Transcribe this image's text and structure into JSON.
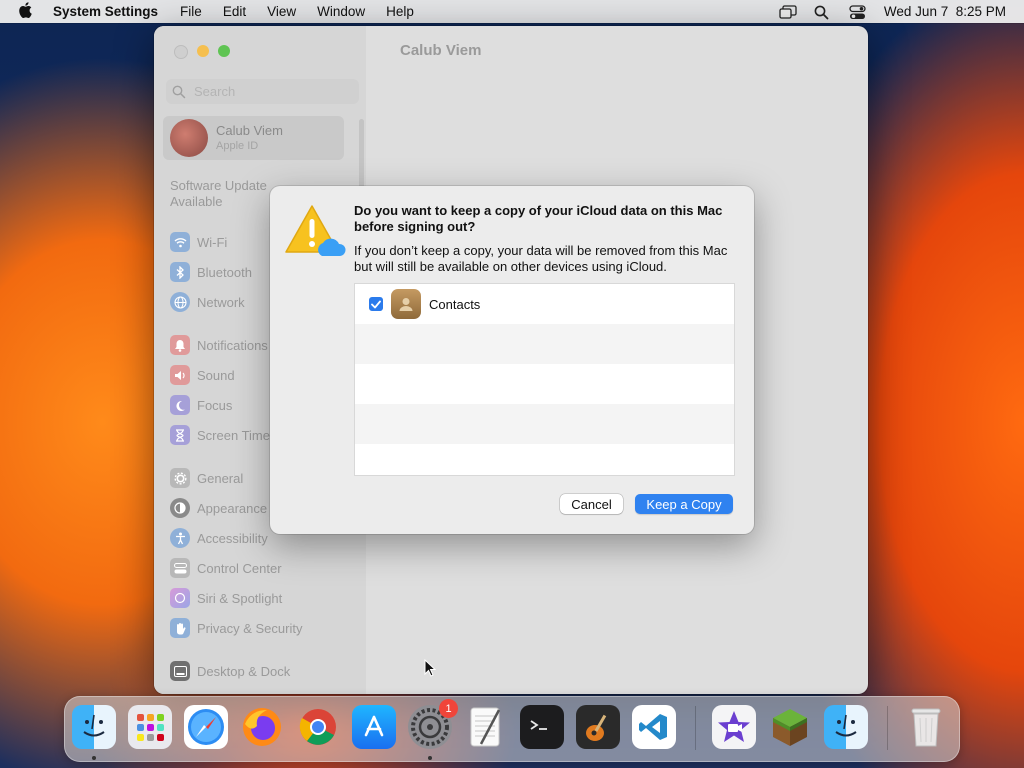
{
  "menubar": {
    "app_name": "System Settings",
    "items": [
      "File",
      "Edit",
      "View",
      "Window",
      "Help"
    ],
    "clock": "Wed Jun 7  8:25 PM"
  },
  "window": {
    "title": "Calub Viem",
    "search_placeholder": "Search",
    "account": {
      "name": "Calub Viem",
      "subtitle": "Apple ID"
    },
    "software_update": "Software Update\nAvailable",
    "sidebar_items": [
      {
        "label": "Wi-Fi",
        "icon": "wifi-icon",
        "color": "#8fb0d8"
      },
      {
        "label": "Bluetooth",
        "icon": "bluetooth-icon",
        "color": "#8fb0d8"
      },
      {
        "label": "Network",
        "icon": "network-icon",
        "color": "#8fb0d8"
      },
      {
        "label": "Notifications",
        "icon": "notifications-icon",
        "color": "#e09a9a"
      },
      {
        "label": "Sound",
        "icon": "sound-icon",
        "color": "#e09a9a"
      },
      {
        "label": "Focus",
        "icon": "focus-icon",
        "color": "#a6a0d8"
      },
      {
        "label": "Screen Time",
        "icon": "screen-time-icon",
        "color": "#a6a0d8"
      },
      {
        "label": "General",
        "icon": "general-icon",
        "color": "#b8b8b8"
      },
      {
        "label": "Appearance",
        "icon": "appearance-icon",
        "color": "#8a8a8a"
      },
      {
        "label": "Accessibility",
        "icon": "accessibility-icon",
        "color": "#8fb0d8"
      },
      {
        "label": "Control Center",
        "icon": "control-center-icon",
        "color": "#b8b8b8"
      },
      {
        "label": "Siri & Spotlight",
        "icon": "siri-icon",
        "color": "#c49ad8"
      },
      {
        "label": "Privacy & Security",
        "icon": "privacy-icon",
        "color": "#8fb0d8"
      },
      {
        "label": "Desktop & Dock",
        "icon": "desktop-dock-icon",
        "color": "#8a8a8a"
      }
    ]
  },
  "dialog": {
    "title": "Do you want to keep a copy of your iCloud data on this Mac before signing out?",
    "body": "If you don’t keep a copy, your data will be removed from this Mac but will still be available on other devices using iCloud.",
    "items": [
      {
        "label": "Contacts",
        "checked": true
      }
    ],
    "cancel_label": "Cancel",
    "keep_label": "Keep a Copy"
  },
  "dock": {
    "apps": [
      "Finder",
      "Launchpad",
      "Safari",
      "Firefox",
      "Chrome",
      "App Store",
      "System Settings",
      "TextEdit",
      "Terminal",
      "GarageBand",
      "Visual Studio Code",
      "iMovie",
      "Minecraft",
      "Finder",
      "Trash"
    ],
    "settings_badge": "1"
  },
  "colors": {
    "accent": "#2f82f0",
    "dialog_bg": "#ececec"
  }
}
